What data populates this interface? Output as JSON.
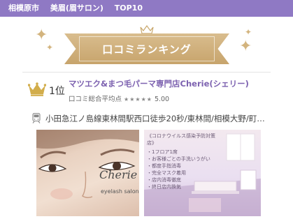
{
  "breadcrumb": {
    "items": [
      "相模原市",
      "美眉(眉サロン)",
      "TOP10"
    ]
  },
  "banner": {
    "title": "口コミランキング"
  },
  "ranking": {
    "rank_label": "1位",
    "shop_name": "マツエク&まつ毛パーマ専門店Cherie(シェリー)",
    "rating_label": "口コミ総合平均点",
    "stars": "★★★★★",
    "rating_value": "5.00",
    "rating_score": 5
  },
  "access": {
    "text": "小田急江ノ島線東林間駅西口徒歩20秒/東林間/相模大野/町…"
  },
  "photo_left": {
    "script": "Cherie",
    "caption": "eyelash salon"
  },
  "photo_right": {
    "title": "《コロナウイルス感染予防対策店》",
    "items": [
      "・1フロア1席",
      "・お客様ごとの手洗いうがい",
      "・都度手指消毒",
      "・完全マスク着用",
      "・店内消毒徹底",
      "・終日店内換気"
    ]
  },
  "colors": {
    "header_purple": "#8f79c4",
    "gold": "#c7a46c",
    "link_purple": "#7d62b0"
  }
}
